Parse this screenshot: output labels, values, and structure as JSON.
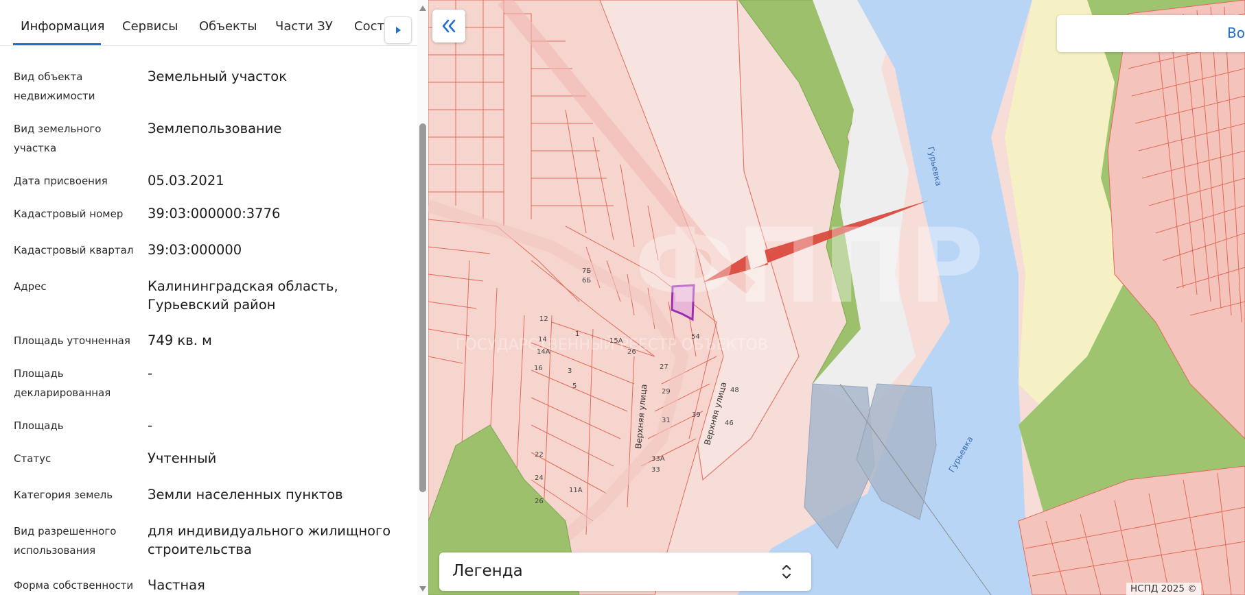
{
  "tabs": [
    {
      "label": "Информация",
      "active": true
    },
    {
      "label": "Сервисы",
      "active": false
    },
    {
      "label": "Объекты",
      "active": false
    },
    {
      "label": "Части ЗУ",
      "active": false
    },
    {
      "label": "Соста",
      "active": false
    }
  ],
  "info": [
    {
      "label": "Вид объекта недвижимости",
      "value": "Земельный участок"
    },
    {
      "label": "Вид земельного участка",
      "value": "Землепользование"
    },
    {
      "label": "Дата присвоения",
      "value": "05.03.2021"
    },
    {
      "label": "Кадастровый номер",
      "value": "39:03:000000:3776"
    },
    {
      "label": "Кадастровый квартал",
      "value": "39:03:000000"
    },
    {
      "label": "Адрес",
      "value": "Калининградская область, Гурьевский район"
    },
    {
      "label": "Площадь уточненная",
      "value": "749 кв. м"
    },
    {
      "label": "Площадь декларированная",
      "value": "-"
    },
    {
      "label": "Площадь",
      "value": "-"
    },
    {
      "label": "Статус",
      "value": "Учтенный"
    },
    {
      "label": "Категория земель",
      "value": "Земли населенных пунктов"
    },
    {
      "label": "Вид разрешенного использования",
      "value": "для индивидуального жилищного строительства"
    },
    {
      "label": "Форма собственности",
      "value": "Частная"
    }
  ],
  "map": {
    "search_link": "Во",
    "legend_title": "Легенда",
    "attribution": "НСПД 2025 ©",
    "river_labels": [
      "Гурьевка",
      "Гурьевка"
    ],
    "street_labels": [
      "Верхняя улица",
      "Верхняя улица"
    ],
    "house_numbers": [
      "7Б",
      "6Б",
      "12",
      "14",
      "14А",
      "16",
      "1",
      "3",
      "5",
      "15А",
      "26",
      "27",
      "29",
      "31",
      "33А",
      "33",
      "39",
      "46",
      "48",
      "54",
      "22",
      "24",
      "26",
      "11А"
    ],
    "watermark_text": "ГОСУДАРСТВЕННЫЙ РЕЕСТР ОБЪЕКТОВ",
    "watermark_logo": "ФППР"
  },
  "colors": {
    "accent": "#1f6fd1",
    "parcel_fill": "#f6d5cf",
    "parcel_stroke": "#e06a55",
    "water": "#b7d4f5",
    "greenery": "#9fc46f",
    "selected_parcel": "#9a2fb0",
    "arrow": "#d9453a"
  }
}
